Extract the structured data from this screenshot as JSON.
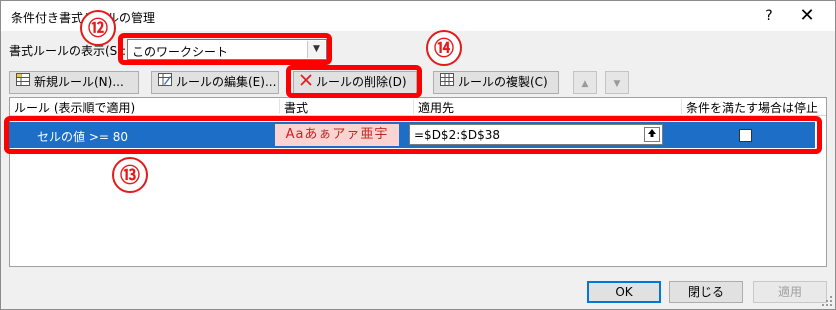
{
  "window": {
    "title": "条件付き書式ルールの管理",
    "help_glyph": "?",
    "close_glyph": "✕"
  },
  "show_rules": {
    "label": "書式ルールの表示(S):",
    "selected": "このワークシート"
  },
  "toolbar": {
    "new_rule": "新規ルール(N)...",
    "edit_rule": "ルールの編集(E)...",
    "delete_rule": "ルールの削除(D)",
    "duplicate_rule": "ルールの複製(C)",
    "move_up_glyph": "▲",
    "move_down_glyph": "▼"
  },
  "table": {
    "headers": [
      "ルール (表示順で適用)",
      "書式",
      "適用先",
      "条件を満たす場合は停止"
    ],
    "rows": [
      {
        "rule": "セルの値 >= 80",
        "format_sample": "Aaあぁアァ亜宇",
        "applies_to": "=$D$2:$D$38",
        "stop_if_true": false
      }
    ]
  },
  "buttons": {
    "ok": "OK",
    "close": "閉じる",
    "apply": "適用"
  },
  "annotations": {
    "badge_12": "⑫",
    "badge_13": "⑬",
    "badge_14": "⑭"
  },
  "colors": {
    "selection": "#1c6ec7",
    "highlight": "#ff0000",
    "format_bg": "#fbd3d3",
    "format_fg": "#c0281f"
  }
}
